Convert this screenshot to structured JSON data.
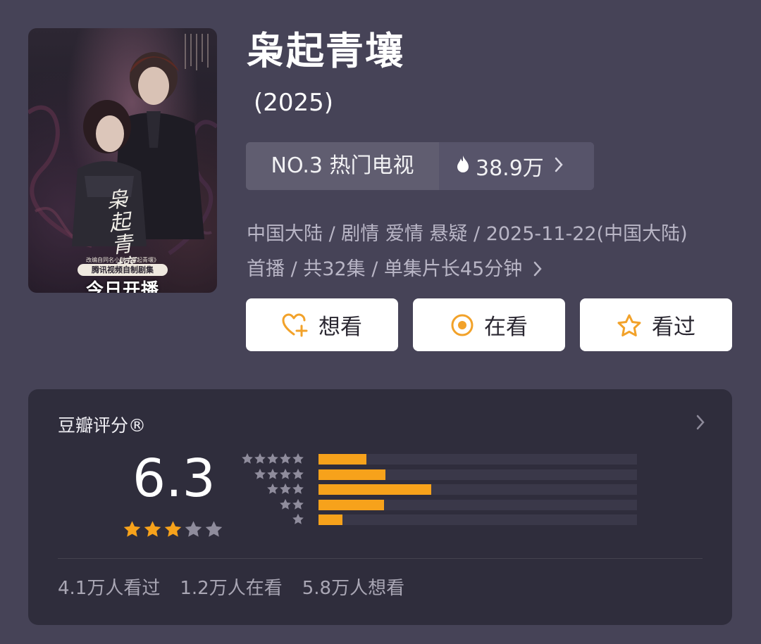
{
  "poster": {
    "vertical_title": "枭起青壤",
    "sub_text": "改编自同名小说《枭起青壤》",
    "badge": "腾讯视频自制剧集",
    "slogan": "今日开播"
  },
  "title": "枭起青壤",
  "year": "(2025)",
  "rank": {
    "label": "NO.3 热门电视",
    "heat": "38.9万"
  },
  "meta": {
    "line1": "中国大陆 / 剧情 爱情 悬疑 / 2025-11-22(中国大陆)",
    "line2": "首播 / 共32集 / 单集片长45分钟"
  },
  "buttons": {
    "want": "想看",
    "watching": "在看",
    "watched": "看过"
  },
  "rating": {
    "label": "豆瓣评分®",
    "score": "6.3",
    "stars_filled": 3,
    "stars_total": 5,
    "distribution": [
      {
        "stars": 5,
        "fraction": 0.15
      },
      {
        "stars": 4,
        "fraction": 0.21
      },
      {
        "stars": 3,
        "fraction": 0.355
      },
      {
        "stars": 2,
        "fraction": 0.205
      },
      {
        "stars": 1,
        "fraction": 0.075
      }
    ],
    "stats": {
      "watched": "4.1万人看过",
      "watching": "1.2万人在看",
      "want": "5.8万人想看"
    }
  },
  "colors": {
    "background": "#464357",
    "card": "#2f2d3c",
    "accent": "#f7a21b",
    "star_empty": "#8f8c9c"
  },
  "icons": [
    "flame-icon",
    "heart-plus-icon",
    "target-icon",
    "star-icon",
    "chevron-right-icon"
  ]
}
